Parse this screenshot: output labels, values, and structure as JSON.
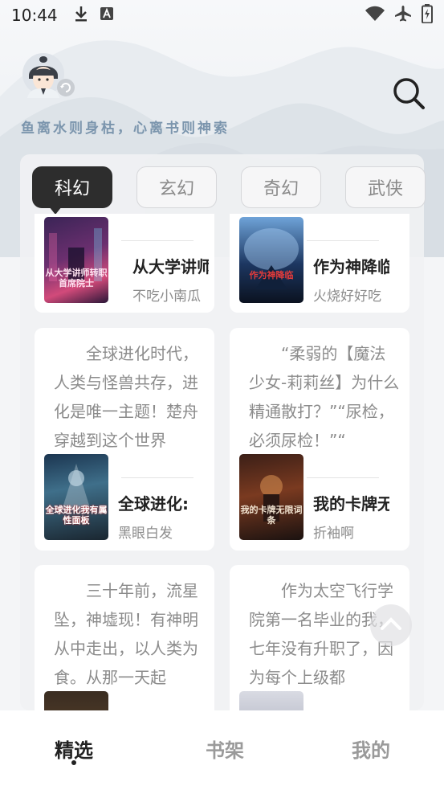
{
  "status_bar": {
    "time": "10:44"
  },
  "header": {
    "slogan": "鱼离水则身枯，心离书则神索"
  },
  "tabs": [
    {
      "label": "科幻",
      "active": true
    },
    {
      "label": "玄幻",
      "active": false
    },
    {
      "label": "奇幻",
      "active": false
    },
    {
      "label": "武侠",
      "active": false
    }
  ],
  "books": [
    {
      "excerpt": "",
      "title": "从大学讲师",
      "author": "不吃小南瓜",
      "cover_title": "从大学讲师转职首席院士"
    },
    {
      "excerpt": "",
      "title": "作为神降临",
      "author": "火烧好好吃",
      "cover_title": "作为神降临"
    },
    {
      "excerpt": "全球进化时代，人类与怪兽共存，进化是唯一主题！楚舟穿越到这个世界",
      "title": "全球进化:",
      "author": "黑眼白发",
      "cover_title": "全球进化我有属性面板"
    },
    {
      "excerpt": "“柔弱的【魔法少女-莉莉丝】为什么精通散打？”“尿检，必须尿检！”“",
      "title": "我的卡牌无",
      "author": "折袖啊",
      "cover_title": "我的卡牌无限词条"
    },
    {
      "excerpt": "三十年前，流星坠，神墟现！有神明从中走出，以人类为食。从那一天起",
      "title": "",
      "author": "",
      "cover_title": ""
    },
    {
      "excerpt": "作为太空飞行学院第一名毕业的我，七年没有升职了，因为每个上级都",
      "title": "",
      "author": "",
      "cover_title": ""
    }
  ],
  "bottom_nav": [
    {
      "label": "精选",
      "active": true
    },
    {
      "label": "书架",
      "active": false
    },
    {
      "label": "我的",
      "active": false
    }
  ],
  "colors": {
    "tab_active_bg": "#2d2d2d",
    "slogan": "#7b95ad",
    "text_muted": "#8c8c8c"
  }
}
